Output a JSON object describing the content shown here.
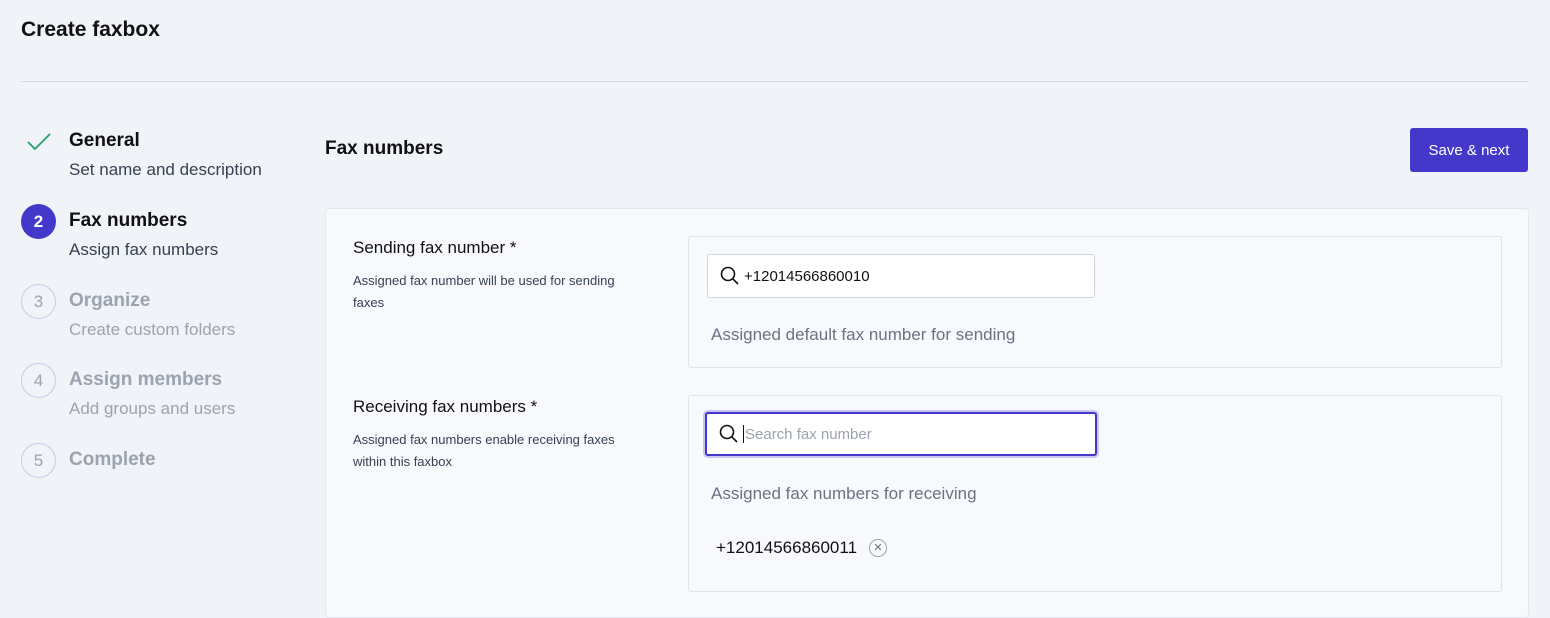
{
  "page": {
    "title": "Create faxbox"
  },
  "steps": [
    {
      "marker": "",
      "title": "General",
      "subtitle": "Set name and description",
      "state": "done"
    },
    {
      "marker": "2",
      "title": "Fax numbers",
      "subtitle": "Assign fax numbers",
      "state": "active"
    },
    {
      "marker": "3",
      "title": "Organize",
      "subtitle": "Create custom folders",
      "state": "pending"
    },
    {
      "marker": "4",
      "title": "Assign members",
      "subtitle": "Add groups and users",
      "state": "pending"
    },
    {
      "marker": "5",
      "title": "Complete",
      "subtitle": "",
      "state": "pending"
    }
  ],
  "main": {
    "title": "Fax numbers",
    "save_label": "Save & next",
    "sending": {
      "label": "Sending fax number *",
      "help": "Assigned fax number will be used for sending faxes",
      "value": "+12014566860010",
      "hint": "Assigned default fax number for sending"
    },
    "receiving": {
      "label": "Receiving fax numbers *",
      "help": "Assigned fax numbers enable receiving faxes within this faxbox",
      "placeholder": "Search fax number",
      "hint": "Assigned fax numbers for receiving",
      "assigned": [
        "+12014566860011"
      ]
    }
  },
  "colors": {
    "accent": "#4338ca",
    "success": "#22a06b",
    "muted": "#9ca3af"
  }
}
